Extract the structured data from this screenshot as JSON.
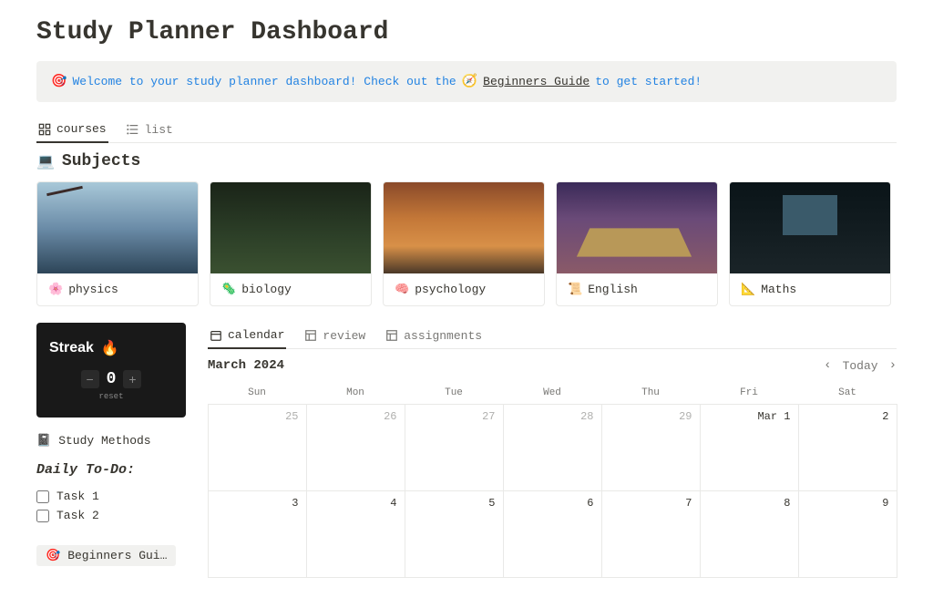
{
  "title": "Study Planner Dashboard",
  "callout": {
    "emoji": "🎯",
    "text_before": "Welcome to your study planner dashboard! Check out the",
    "link_emoji": "🧭",
    "link_text": "Beginners Guide",
    "text_after": "to get started!"
  },
  "tabs": {
    "courses": "courses",
    "list": "list"
  },
  "subjects_head": {
    "emoji": "💻",
    "label": "Subjects"
  },
  "subjects": [
    {
      "emoji": "🌸",
      "label": "physics",
      "cover": "cover-physics"
    },
    {
      "emoji": "🦠",
      "label": "biology",
      "cover": "cover-biology"
    },
    {
      "emoji": "🧠",
      "label": "psychology",
      "cover": "cover-psychology"
    },
    {
      "emoji": "📜",
      "label": "English",
      "cover": "cover-english"
    },
    {
      "emoji": "📐",
      "label": "Maths",
      "cover": "cover-maths"
    }
  ],
  "streak": {
    "title": "Streak",
    "emoji": "🔥",
    "value": "0",
    "reset": "reset"
  },
  "side": {
    "study_methods": "Study Methods",
    "todo_head": "Daily To-Do:",
    "tasks": [
      "Task 1",
      "Task 2"
    ],
    "guide": "Beginners Gui…",
    "guide_emoji": "🎯"
  },
  "cal_tabs": {
    "calendar": "calendar",
    "review": "review",
    "assignments": "assignments"
  },
  "calendar": {
    "title": "March 2024",
    "today": "Today",
    "dow": [
      "Sun",
      "Mon",
      "Tue",
      "Wed",
      "Thu",
      "Fri",
      "Sat"
    ],
    "cells": [
      {
        "t": "25",
        "dim": true
      },
      {
        "t": "26",
        "dim": true
      },
      {
        "t": "27",
        "dim": true
      },
      {
        "t": "28",
        "dim": true
      },
      {
        "t": "29",
        "dim": true
      },
      {
        "t": "Mar 1",
        "dim": false
      },
      {
        "t": "2",
        "dim": false
      },
      {
        "t": "3",
        "dim": false
      },
      {
        "t": "4",
        "dim": false
      },
      {
        "t": "5",
        "dim": false
      },
      {
        "t": "6",
        "dim": false
      },
      {
        "t": "7",
        "dim": false
      },
      {
        "t": "8",
        "dim": false
      },
      {
        "t": "9",
        "dim": false
      }
    ]
  }
}
